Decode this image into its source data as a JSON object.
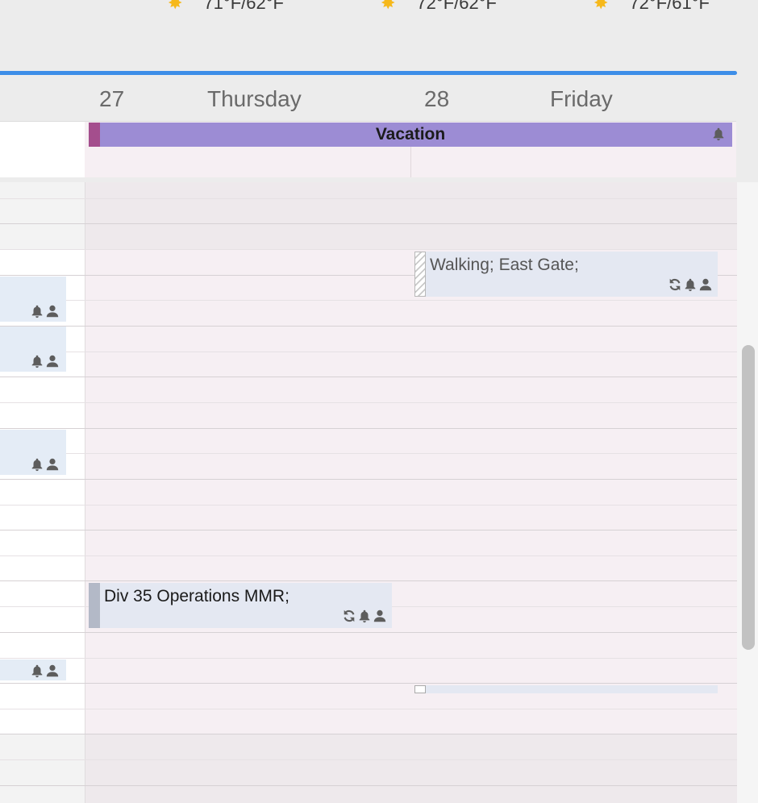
{
  "weather": [
    {
      "icon": "sun-icon",
      "temp": "71°F/62°F"
    },
    {
      "icon": "sun-icon",
      "temp": "72°F/62°F"
    },
    {
      "icon": "sun-icon",
      "temp": "72°F/61°F"
    }
  ],
  "header": {
    "day1_date": "27",
    "day1_name": "Thursday",
    "day2_date": "28",
    "day2_name": "Friday"
  },
  "allday": {
    "vacation": {
      "title": "Vacation",
      "color": "#9c8cd4",
      "stripe_color": "#a44e8d",
      "icons": [
        "bell-icon"
      ]
    }
  },
  "events": {
    "walking": {
      "title": "Walking; East Gate;",
      "icons": [
        "recurring-icon",
        "bell-icon",
        "attendees-icon"
      ]
    },
    "div35": {
      "title": "Div 35 Operations MMR;",
      "icons": [
        "recurring-icon",
        "bell-icon",
        "attendees-icon"
      ]
    }
  },
  "left_events": [
    {
      "icons": [
        "bell-icon",
        "attendees-icon"
      ]
    },
    {
      "icons": [
        "bell-icon",
        "attendees-icon"
      ]
    },
    {
      "icons": [
        "bell-icon",
        "attendees-icon"
      ]
    },
    {
      "icons": [
        "bell-icon",
        "attendees-icon"
      ]
    }
  ],
  "colors": {
    "accent": "#3d8ee8",
    "day_background": "#f6eff3",
    "event_background": "#e4e8f2"
  }
}
